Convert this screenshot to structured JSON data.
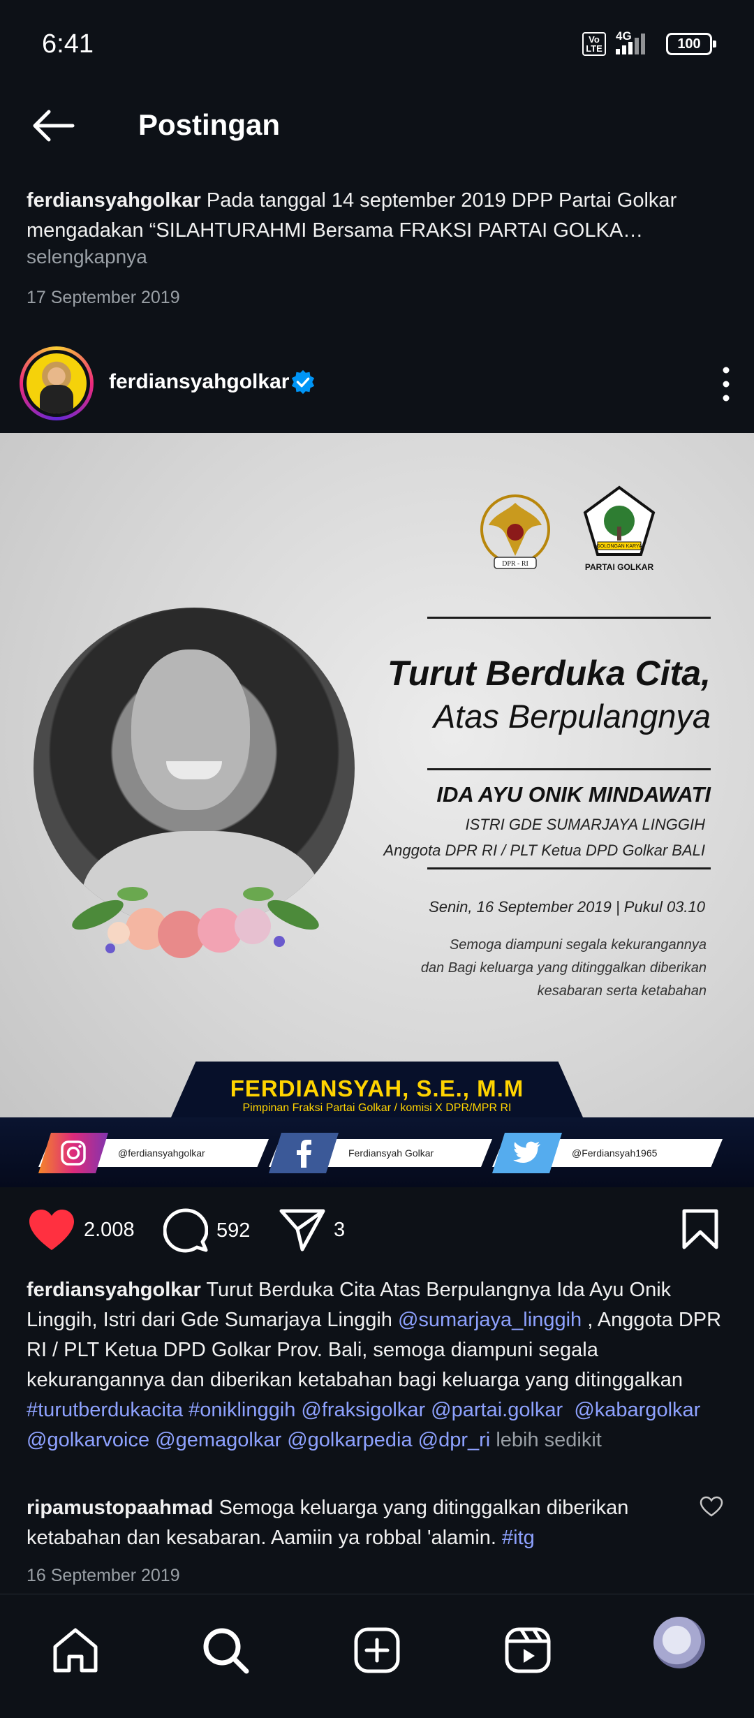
{
  "status_bar": {
    "time": "6:41",
    "network": "4G",
    "volte": "Vo LTE",
    "battery": "100"
  },
  "header": {
    "title": "Postingan"
  },
  "previous_post": {
    "username": "ferdiansyahgolkar",
    "caption": "Pada tanggal  14 september 2019 DPP Partai Golkar mengadakan “SILAHTURAHMI Bersama FRAKSI PARTAI GOLKA…",
    "more_label": "selengkapnya",
    "date": "17 September 2019"
  },
  "post": {
    "username": "ferdiansyahgolkar",
    "image": {
      "dpr_label": "DPR - RI",
      "golkar_top": "GOLONGAN KARYA",
      "golkar_bottom": "PARTAI GOLKAR",
      "heading1": "Turut Berduka Cita,",
      "heading2": "Atas Berpulangnya",
      "name": "IDA AYU ONIK MINDAWATI",
      "line1": "ISTRI GDE SUMARJAYA LINGGIH",
      "line2": "Anggota DPR RI / PLT Ketua DPD Golkar BALI",
      "date": "Senin, 16 September 2019 | Pukul 03.10",
      "wish1": "Semoga diampuni segala kekurangannya",
      "wish2": "dan Bagi keluarga yang ditinggalkan diberikan",
      "wish3": "kesabaran serta ketabahan",
      "banner_name": "FERDIANSYAH, S.E., M.M",
      "banner_sub": "Pimpinan Fraksi Partai Golkar / komisi X DPR/MPR RI",
      "instagram": "@ferdiansyahgolkar",
      "facebook": "Ferdiansyah Golkar",
      "twitter": "@Ferdiansyah1965"
    },
    "likes": "2.008",
    "comments": "592",
    "shares": "3",
    "caption": {
      "username": "ferdiansyahgolkar",
      "text1": "Turut Berduka Cita Atas Berpulangnya Ida Ayu Onik Linggih, Istri dari Gde Sumarjaya Linggih ",
      "mention1": "@sumarjaya_linggih",
      "text2": " , Anggota DPR RI / PLT Ketua DPD Golkar Prov. Bali, semoga diampuni segala kekurangannya dan diberikan ketabahan bagi keluarga yang ditinggalkan ",
      "tag1": "#turutberdukacita",
      "tag2": "#oniklinggih",
      "mention2": "@fraksigolkar",
      "mention3": "@partai.golkar",
      "mention4": "@kabargolkar",
      "mention5": "@golkarvoice",
      "mention6": "@gemagolkar",
      "mention7": "@golkarpedia",
      "mention8": "@dpr_ri",
      "less_label": "lebih sedikit"
    },
    "comment": {
      "username": "ripamustopaahmad",
      "text": "Semoga keluarga yang ditinggalkan diberikan ketabahan dan kesabaran. Aamiin ya robbal 'alamin. ",
      "tag": "#itg"
    },
    "date": "16 September 2019"
  },
  "colors": {
    "background": "#0d1117",
    "link": "#8ea2ff",
    "like": "#ff3040",
    "verified": "#0095f6"
  }
}
